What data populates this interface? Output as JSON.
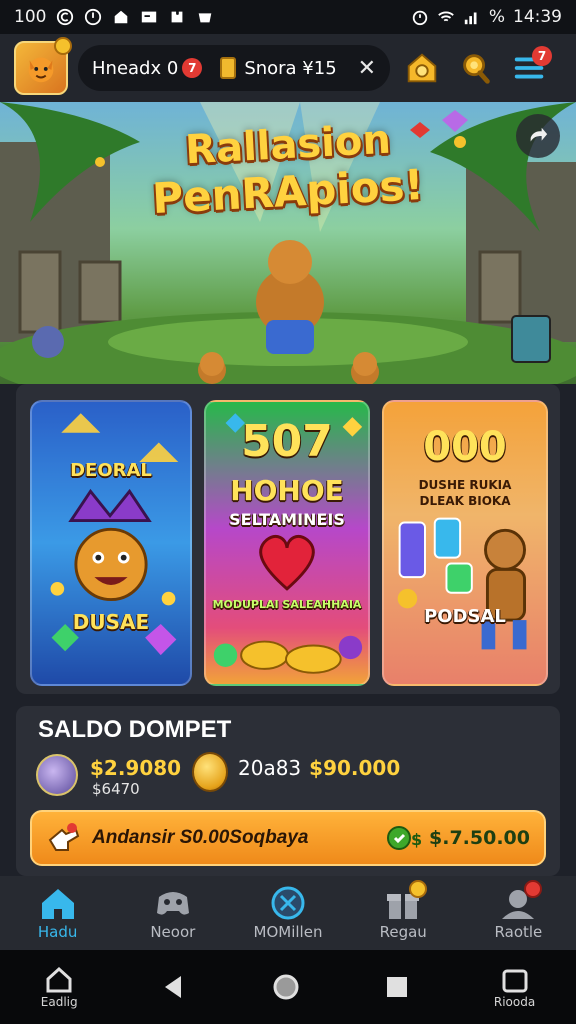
{
  "status_bar": {
    "time_left": "100",
    "time_right": "14:39",
    "battery": "%"
  },
  "top_bar": {
    "username": "Hneadx 0",
    "notif_count": "7",
    "ticket_label": "Snora ¥15",
    "menu_badge": "7"
  },
  "hero": {
    "title_line1": "Rallasion",
    "title_line2": "PenRApios!"
  },
  "cards": [
    {
      "top_text": "DEORAL",
      "bottom_text": "DUSAE"
    },
    {
      "number": "507",
      "line1": "HOHOE",
      "line2": "SELTAMINEIS",
      "caption": "MODUPLAI SALEAHHAIA"
    },
    {
      "number": "000",
      "line1": "DUSHE RUKIA",
      "line2": "DLEAK BIOKA",
      "caption": "PODSAL"
    }
  ],
  "wallet": {
    "title": "SALDO DOMPET",
    "balance_main": "$2.9080",
    "balance_sub": "$6470",
    "balance_label": "20a83",
    "balance_secondary": "$90.000",
    "action_label": "Andansir S0.00Soqbaya",
    "action_cash": "$.7.50.00"
  },
  "bottom_nav": [
    {
      "label": "Hadu",
      "icon": "home-icon",
      "active": true
    },
    {
      "label": "Neoor",
      "icon": "game-controller-icon",
      "active": false
    },
    {
      "label": "MOMillen",
      "icon": "x-circle-icon",
      "active": false
    },
    {
      "label": "Regau",
      "icon": "gift-icon",
      "active": false
    },
    {
      "label": "Raotle",
      "icon": "profile-icon",
      "active": false
    }
  ],
  "system_nav": {
    "left_label": "Eadlig",
    "right_label": "Riooda"
  },
  "colors": {
    "accent": "#38b8ec",
    "gold": "#ffd23f",
    "orange": "#ef8a1a",
    "panel": "#2c2f37"
  }
}
